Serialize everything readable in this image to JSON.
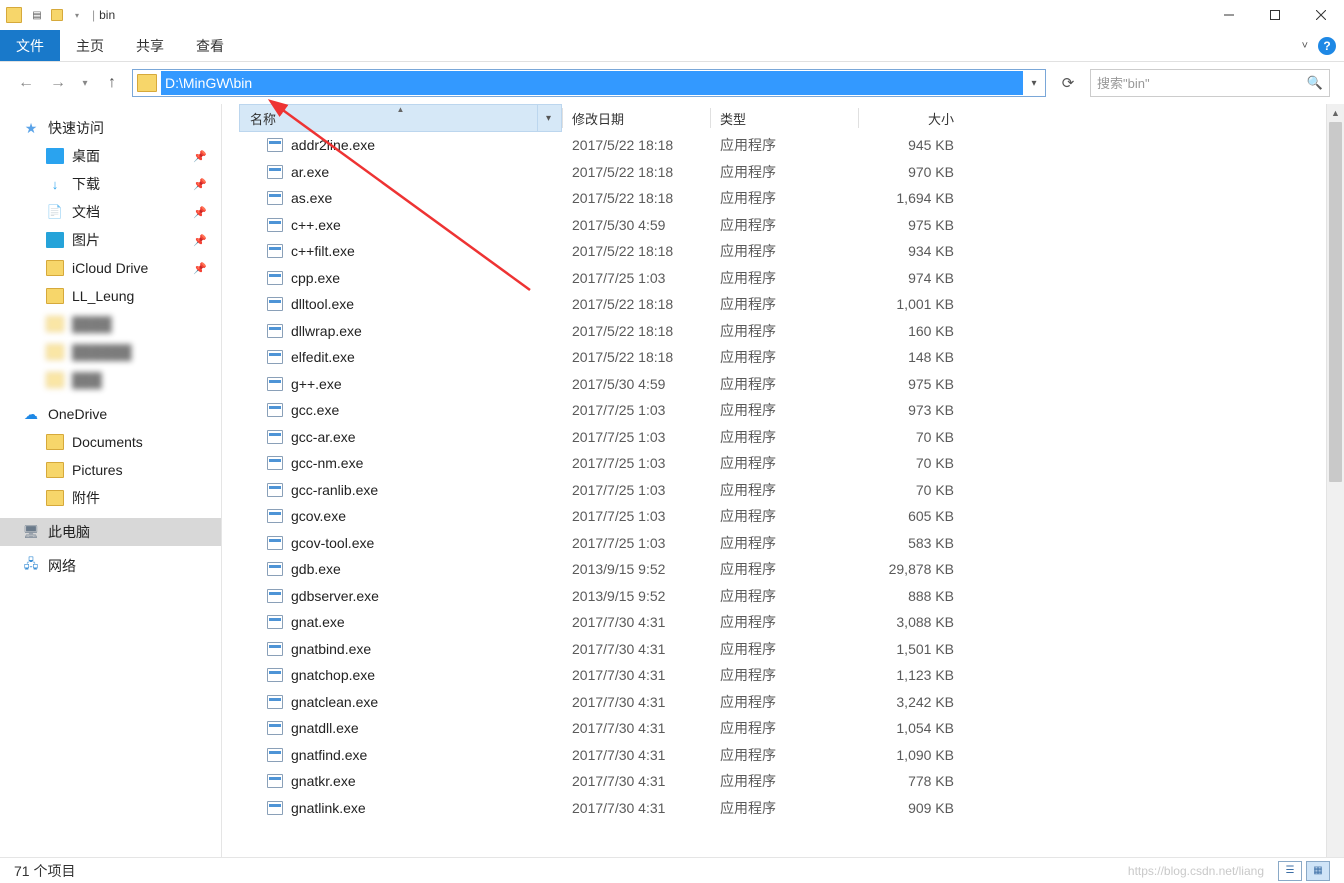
{
  "window_title": "bin",
  "ribbon": {
    "file": "文件",
    "home": "主页",
    "share": "共享",
    "view": "查看"
  },
  "nav": {
    "address": "D:\\MinGW\\bin",
    "search_placeholder": "搜索\"bin\""
  },
  "side": {
    "quick": "快速访问",
    "quick_items": [
      {
        "label": "桌面",
        "icon": "desk",
        "pin": true
      },
      {
        "label": "下载",
        "icon": "dl",
        "pin": true
      },
      {
        "label": "文档",
        "icon": "doc",
        "pin": true
      },
      {
        "label": "图片",
        "icon": "pic",
        "pin": true
      },
      {
        "label": "iCloud Drive",
        "icon": "folder",
        "pin": true
      },
      {
        "label": "LL_Leung",
        "icon": "folder",
        "pin": false
      }
    ],
    "onedrive": "OneDrive",
    "onedrive_items": [
      "Documents",
      "Pictures",
      "附件"
    ],
    "thispc": "此电脑",
    "network": "网络"
  },
  "columns": {
    "name": "名称",
    "date": "修改日期",
    "type": "类型",
    "size": "大小"
  },
  "type_label": "应用程序",
  "files": [
    {
      "n": "addr2line.exe",
      "d": "2017/5/22 18:18",
      "s": "945 KB"
    },
    {
      "n": "ar.exe",
      "d": "2017/5/22 18:18",
      "s": "970 KB"
    },
    {
      "n": "as.exe",
      "d": "2017/5/22 18:18",
      "s": "1,694 KB"
    },
    {
      "n": "c++.exe",
      "d": "2017/5/30 4:59",
      "s": "975 KB"
    },
    {
      "n": "c++filt.exe",
      "d": "2017/5/22 18:18",
      "s": "934 KB"
    },
    {
      "n": "cpp.exe",
      "d": "2017/7/25 1:03",
      "s": "974 KB"
    },
    {
      "n": "dlltool.exe",
      "d": "2017/5/22 18:18",
      "s": "1,001 KB"
    },
    {
      "n": "dllwrap.exe",
      "d": "2017/5/22 18:18",
      "s": "160 KB"
    },
    {
      "n": "elfedit.exe",
      "d": "2017/5/22 18:18",
      "s": "148 KB"
    },
    {
      "n": "g++.exe",
      "d": "2017/5/30 4:59",
      "s": "975 KB"
    },
    {
      "n": "gcc.exe",
      "d": "2017/7/25 1:03",
      "s": "973 KB"
    },
    {
      "n": "gcc-ar.exe",
      "d": "2017/7/25 1:03",
      "s": "70 KB"
    },
    {
      "n": "gcc-nm.exe",
      "d": "2017/7/25 1:03",
      "s": "70 KB"
    },
    {
      "n": "gcc-ranlib.exe",
      "d": "2017/7/25 1:03",
      "s": "70 KB"
    },
    {
      "n": "gcov.exe",
      "d": "2017/7/25 1:03",
      "s": "605 KB"
    },
    {
      "n": "gcov-tool.exe",
      "d": "2017/7/25 1:03",
      "s": "583 KB"
    },
    {
      "n": "gdb.exe",
      "d": "2013/9/15 9:52",
      "s": "29,878 KB"
    },
    {
      "n": "gdbserver.exe",
      "d": "2013/9/15 9:52",
      "s": "888 KB"
    },
    {
      "n": "gnat.exe",
      "d": "2017/7/30 4:31",
      "s": "3,088 KB"
    },
    {
      "n": "gnatbind.exe",
      "d": "2017/7/30 4:31",
      "s": "1,501 KB"
    },
    {
      "n": "gnatchop.exe",
      "d": "2017/7/30 4:31",
      "s": "1,123 KB"
    },
    {
      "n": "gnatclean.exe",
      "d": "2017/7/30 4:31",
      "s": "3,242 KB"
    },
    {
      "n": "gnatdll.exe",
      "d": "2017/7/30 4:31",
      "s": "1,054 KB"
    },
    {
      "n": "gnatfind.exe",
      "d": "2017/7/30 4:31",
      "s": "1,090 KB"
    },
    {
      "n": "gnatkr.exe",
      "d": "2017/7/30 4:31",
      "s": "778 KB"
    },
    {
      "n": "gnatlink.exe",
      "d": "2017/7/30 4:31",
      "s": "909 KB"
    }
  ],
  "status": {
    "count": "71 个项目",
    "wm": "https://blog.csdn.net/liang"
  }
}
